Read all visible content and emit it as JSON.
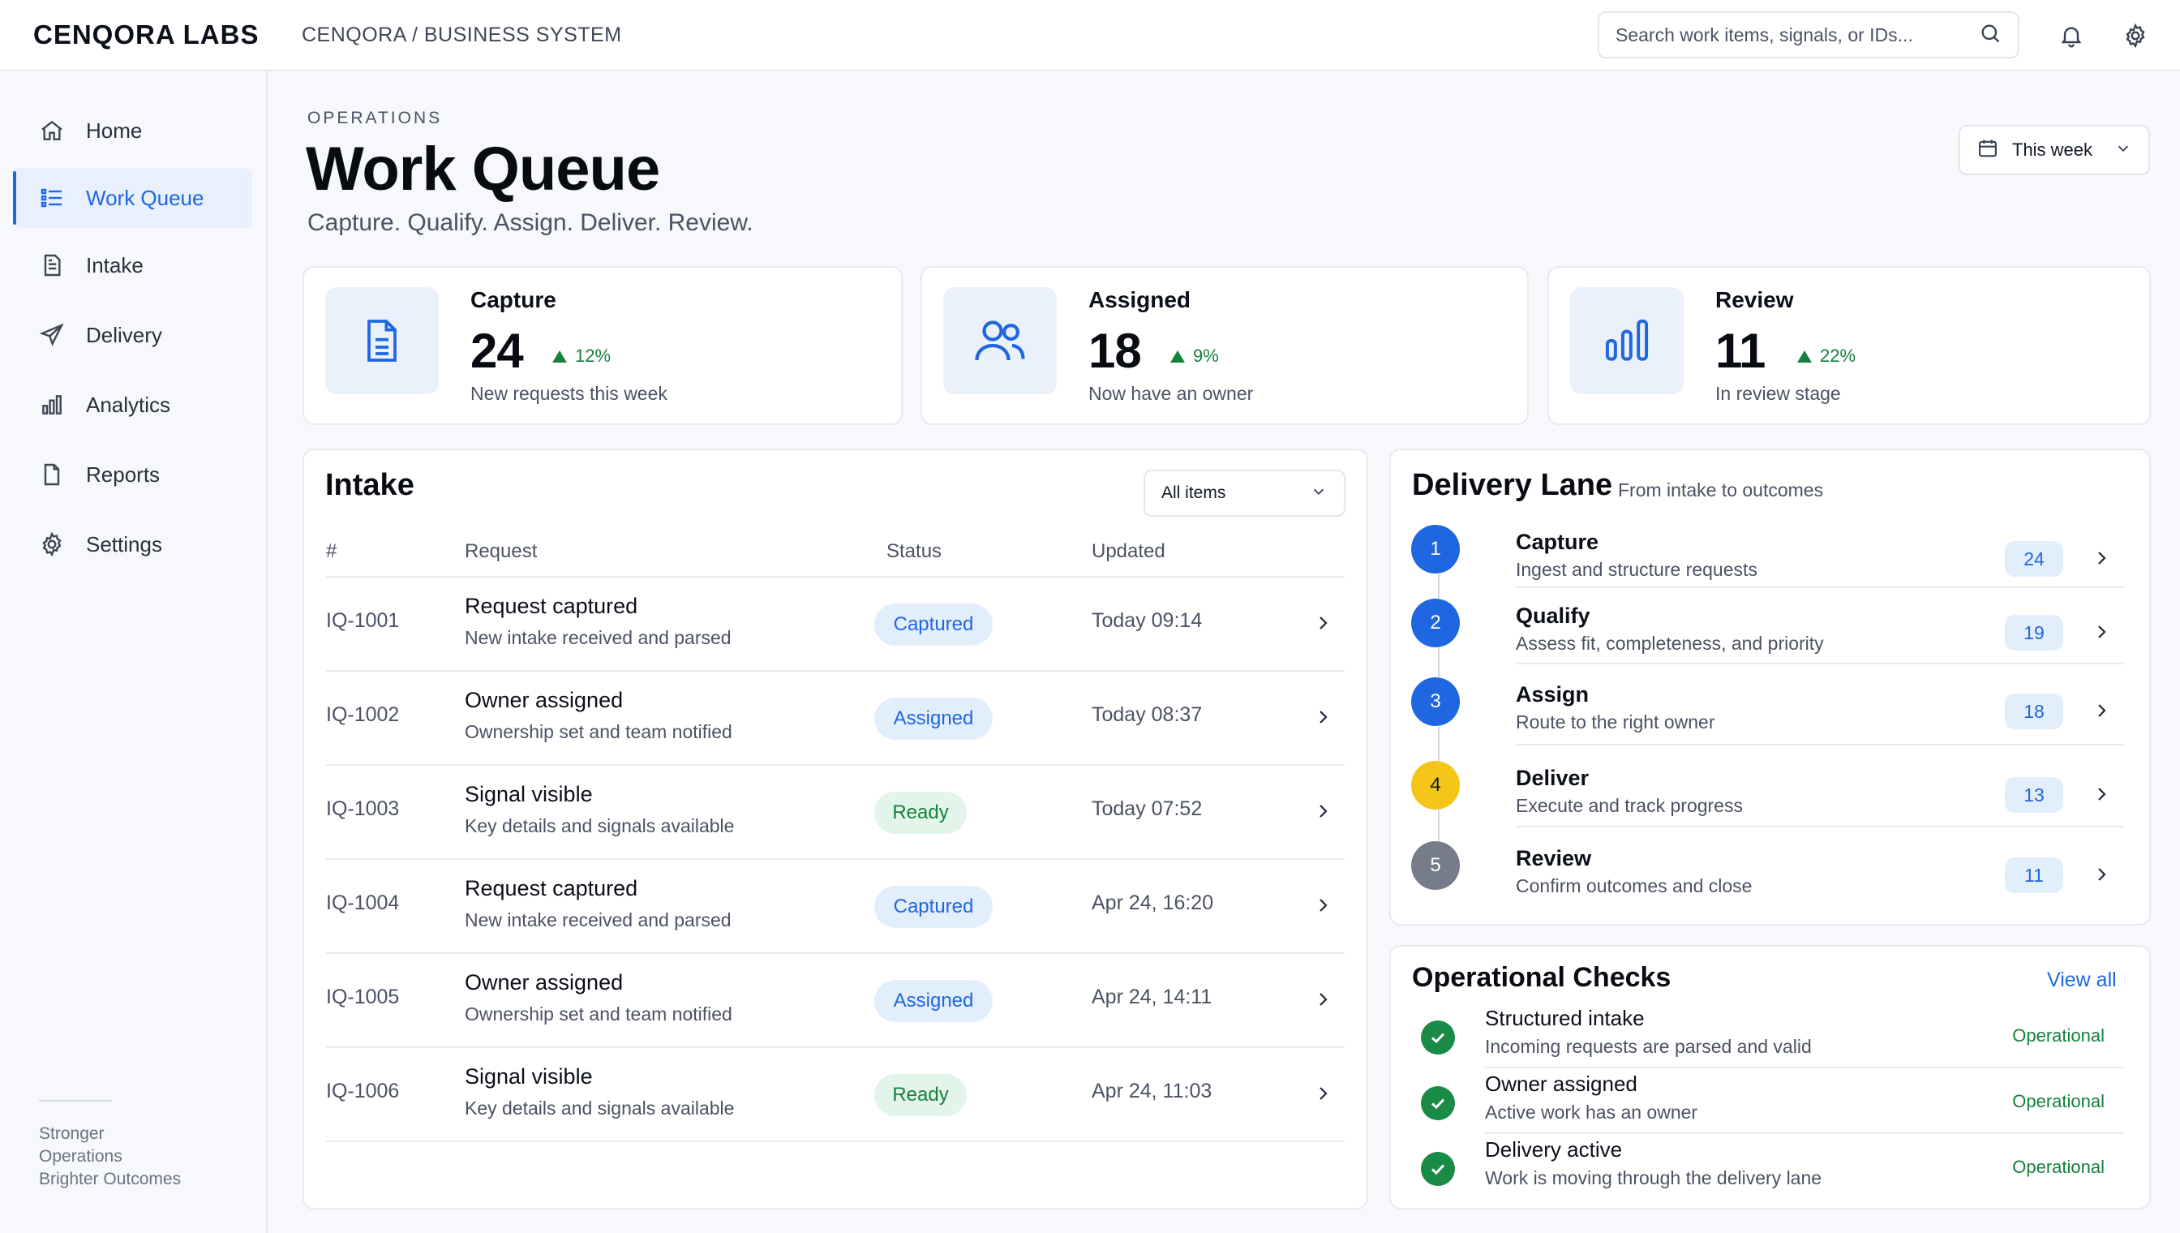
{
  "brand": "CENQORA LABS",
  "breadcrumb": "CENQORA / BUSINESS SYSTEM",
  "search": {
    "placeholder": "Search work items, signals, or IDs..."
  },
  "topbar_icons": [
    "search-icon",
    "bell-icon",
    "gear-icon"
  ],
  "sidebar": {
    "items": [
      {
        "label": "Home",
        "icon": "home-icon",
        "active": false
      },
      {
        "label": "Work Queue",
        "icon": "list-icon",
        "active": true
      },
      {
        "label": "Intake",
        "icon": "document-icon",
        "active": false
      },
      {
        "label": "Delivery",
        "icon": "send-icon",
        "active": false
      },
      {
        "label": "Analytics",
        "icon": "bar-chart-icon",
        "active": false
      },
      {
        "label": "Reports",
        "icon": "file-icon",
        "active": false
      },
      {
        "label": "Settings",
        "icon": "gear-icon",
        "active": false
      }
    ],
    "footer": [
      "Stronger",
      "Operations",
      "Brighter Outcomes"
    ]
  },
  "header": {
    "eyebrow": "OPERATIONS",
    "title": "Work Queue",
    "subtitle": "Capture. Qualify. Assign. Deliver. Review.",
    "range": "This week"
  },
  "stats": [
    {
      "title": "Capture",
      "value": "24",
      "delta": "12%",
      "note": "New requests this week",
      "icon": "document-icon"
    },
    {
      "title": "Assigned",
      "value": "18",
      "delta": "9%",
      "note": "Now have an owner",
      "icon": "users-icon"
    },
    {
      "title": "Review",
      "value": "11",
      "delta": "22%",
      "note": "In review stage",
      "icon": "bar-chart-icon"
    }
  ],
  "intake": {
    "title": "Intake",
    "filter": "All items",
    "columns": [
      "#",
      "Request",
      "Status",
      "Updated"
    ],
    "rows": [
      {
        "id": "IQ-1001",
        "title": "Request captured",
        "desc": "New intake received and parsed",
        "status": "Captured",
        "tone": "blue",
        "updated": "Today 09:14"
      },
      {
        "id": "IQ-1002",
        "title": "Owner assigned",
        "desc": "Ownership set and team notified",
        "status": "Assigned",
        "tone": "blue",
        "updated": "Today 08:37"
      },
      {
        "id": "IQ-1003",
        "title": "Signal visible",
        "desc": "Key details and signals available",
        "status": "Ready",
        "tone": "green",
        "updated": "Today 07:52"
      },
      {
        "id": "IQ-1004",
        "title": "Request captured",
        "desc": "New intake received and parsed",
        "status": "Captured",
        "tone": "blue",
        "updated": "Apr 24, 16:20"
      },
      {
        "id": "IQ-1005",
        "title": "Owner assigned",
        "desc": "Ownership set and team notified",
        "status": "Assigned",
        "tone": "blue",
        "updated": "Apr 24, 14:11"
      },
      {
        "id": "IQ-1006",
        "title": "Signal visible",
        "desc": "Key details and signals available",
        "status": "Ready",
        "tone": "green",
        "updated": "Apr 24, 11:03"
      }
    ]
  },
  "lane": {
    "title": "Delivery Lane",
    "subtitle": "From intake to outcomes",
    "steps": [
      {
        "num": "1",
        "name": "Capture",
        "desc": "Ingest and structure requests",
        "count": "24",
        "color": "#1f67e0"
      },
      {
        "num": "2",
        "name": "Qualify",
        "desc": "Assess fit, completeness, and priority",
        "count": "19",
        "color": "#1f67e0"
      },
      {
        "num": "3",
        "name": "Assign",
        "desc": "Route to the right owner",
        "count": "18",
        "color": "#1f67e0"
      },
      {
        "num": "4",
        "name": "Deliver",
        "desc": "Execute and track progress",
        "count": "13",
        "color": "#f5c518"
      },
      {
        "num": "5",
        "name": "Review",
        "desc": "Confirm outcomes and close",
        "count": "11",
        "color": "#767c8a"
      }
    ]
  },
  "checks": {
    "title": "Operational Checks",
    "view_all": "View all",
    "items": [
      {
        "name": "Structured intake",
        "desc": "Incoming requests are parsed and valid",
        "status": "Operational"
      },
      {
        "name": "Owner assigned",
        "desc": "Active work has an owner",
        "status": "Operational"
      },
      {
        "name": "Delivery active",
        "desc": "Work is moving through the delivery lane",
        "status": "Operational"
      }
    ]
  },
  "colors": {
    "accent": "#1f67e0",
    "success": "#16803c",
    "warning": "#f5c518",
    "muted": "#767c8a"
  }
}
